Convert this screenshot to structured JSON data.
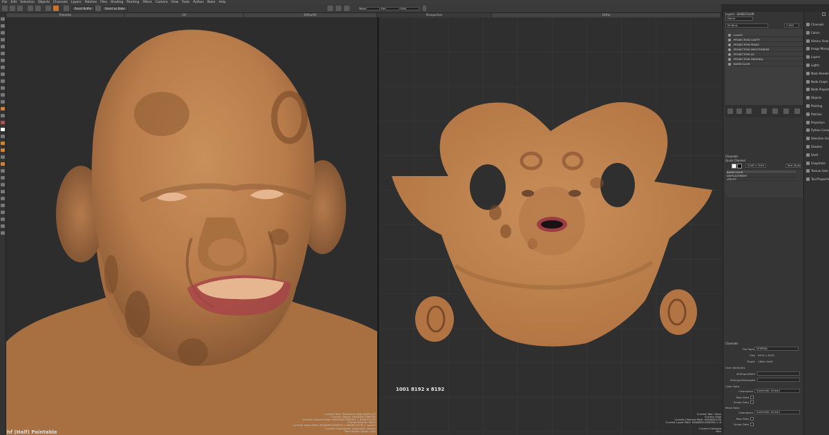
{
  "menubar": {
    "items": [
      "File",
      "Edit",
      "Selection",
      "Objects",
      "Channels",
      "Layers",
      "Patches",
      "Files",
      "Shading",
      "Painting",
      "Filters",
      "Camera",
      "View",
      "Tools",
      "Python",
      "Nuke",
      "Help"
    ]
  },
  "toolbar": {
    "reset_buffer": "Reset Buffer",
    "reset_on_bake": "Reset on Bake",
    "near_label": "Near",
    "far_label": "Far",
    "fov_label": "FoV"
  },
  "viewtabs": {
    "projection": "Projectio",
    "uv": "UV",
    "ortho_uv": "Ortho/UV",
    "perspective": "Perspective",
    "ortho": "Ortho"
  },
  "viewport_left": {
    "paintable": "hf (Half) Paintable",
    "info_lines": [
      "Current Tool: Transform Paint Buffer (P)",
      "Current Object: HEADDECORATED",
      "Current Channel Path: HEADDECORATED > BASECOLOR",
      "Current Shader: BASE",
      "Current Layer Path: HEADDECORATED > BASECOLOR > Layer2",
      "Current Colorspace: Automatic (linear)",
      "Paint Buffer Depth: 8(b)"
    ]
  },
  "viewport_right": {
    "udim": "1001 8192 x 8192",
    "info_lines": [
      "Current Tool: Trans",
      "Current Obje",
      "Current Channel Path: HEADDECOR",
      "Current Layer Path: HEADDECORATED > B",
      "",
      "Current Colorspa",
      "Pain"
    ]
  },
  "layers_panel": {
    "title": "Layers : BASECOLOR",
    "filter": "Name",
    "blend_mode": "Multiply",
    "opacity": "1.000",
    "layers": [
      {
        "name": "Layer2",
        "color": "#3d7fc9"
      },
      {
        "name": "PROJECTION CAVITY",
        "color": "#d03030"
      },
      {
        "name": "PROJECTION PEAKS",
        "color": "#d03030"
      },
      {
        "name": "PROJECTION SMOOTHNESS",
        "color": "#d03030"
      },
      {
        "name": "PROJECTION AO",
        "color": "#d03030"
      },
      {
        "name": "PROJECTION ORIGINAL",
        "color": "#2fb84a"
      },
      {
        "name": "BASECOLOR",
        "color": "#2fb84a"
      }
    ]
  },
  "channels_panel": {
    "title": "Channels",
    "quick_channel": "Quick Channel",
    "size": "2048 x 2048",
    "depth": "8bit (Byte)",
    "channels": [
      "BASECOLOR",
      "DISPLACEMENT",
      "UTILITY"
    ]
  },
  "properties_panel": {
    "header": "Channels",
    "file_space_label": "File Space",
    "file_space": "NORMAL",
    "size_label": "Size",
    "size": "8192 x 8192",
    "depth_label": "Depth",
    "depth": "16bit (Half)",
    "user_attributes": "User Attributes",
    "mr_import_path": "MriImportPath",
    "mr_import_template": "MriImportTemplate",
    "color_data": "Color Data",
    "colorspace_label": "Colorspace",
    "colorspace": "Automatic (linear)",
    "raw_data": "Raw Data",
    "scalar_data": "Scalar Data",
    "mask_data": "Mask Data",
    "mask_colorspace": "Automatic (linear)"
  },
  "sidebar": {
    "items": [
      "Channels",
      "Colors",
      "History View",
      "Image Manager",
      "Layers",
      "Lights",
      "Mods Render",
      "Node Graph",
      "Node Properties",
      "Objects",
      "Painting",
      "Patches",
      "Projectors",
      "Python Console",
      "Selection Groups",
      "Shaders",
      "Shelf",
      "Snapshots",
      "Texture Sets",
      "Tool Properties"
    ]
  },
  "colors": {
    "skin": "#c08552",
    "accent_red": "#d03030",
    "accent_green": "#2fb84a"
  }
}
